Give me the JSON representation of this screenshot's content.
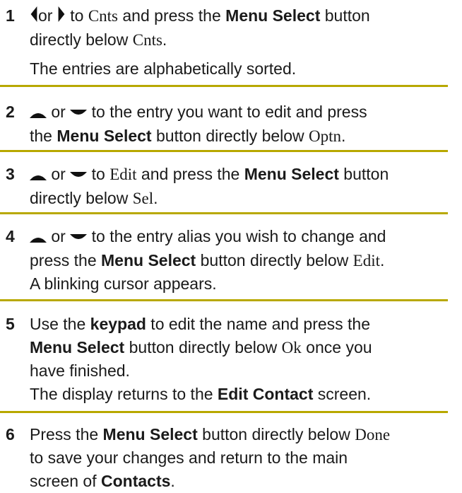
{
  "steps": [
    {
      "num": "1",
      "parts": [
        {
          "t": "icon",
          "name": "left-arrow-icon"
        },
        {
          "t": "text",
          "v": "or "
        },
        {
          "t": "icon",
          "name": "right-arrow-icon"
        },
        {
          "t": "text",
          "v": " to "
        },
        {
          "t": "serif",
          "v": "Cnts"
        },
        {
          "t": "text",
          "v": " and press the "
        },
        {
          "t": "bold",
          "v": "Menu Select"
        },
        {
          "t": "text",
          "v": " button"
        },
        {
          "t": "br"
        },
        {
          "t": "text",
          "v": "directly below "
        },
        {
          "t": "serif",
          "v": "Cnts"
        },
        {
          "t": "text",
          "v": "."
        }
      ],
      "note": "The entries are alphabetically sorted."
    },
    {
      "num": "2",
      "parts": [
        {
          "t": "icon",
          "name": "up-arrow-icon"
        },
        {
          "t": "text",
          "v": " or "
        },
        {
          "t": "icon",
          "name": "down-arrow-icon"
        },
        {
          "t": "text",
          "v": " to the entry you want to edit and press"
        },
        {
          "t": "br"
        },
        {
          "t": "text",
          "v": "the "
        },
        {
          "t": "bold",
          "v": "Menu Select"
        },
        {
          "t": "text",
          "v": " button directly below "
        },
        {
          "t": "serif",
          "v": "Optn"
        },
        {
          "t": "text",
          "v": "."
        }
      ]
    },
    {
      "num": "3",
      "parts": [
        {
          "t": "icon",
          "name": "up-arrow-icon"
        },
        {
          "t": "text",
          "v": " or "
        },
        {
          "t": "icon",
          "name": "down-arrow-icon"
        },
        {
          "t": "text",
          "v": " to "
        },
        {
          "t": "serif",
          "v": "Edit"
        },
        {
          "t": "text",
          "v": " and press the "
        },
        {
          "t": "bold",
          "v": "Menu Select"
        },
        {
          "t": "text",
          "v": " button"
        },
        {
          "t": "br"
        },
        {
          "t": "text",
          "v": "directly below "
        },
        {
          "t": "serif",
          "v": "Sel"
        },
        {
          "t": "text",
          "v": "."
        }
      ]
    },
    {
      "num": "4",
      "parts": [
        {
          "t": "icon",
          "name": "up-arrow-icon"
        },
        {
          "t": "text",
          "v": " or "
        },
        {
          "t": "icon",
          "name": "down-arrow-icon"
        },
        {
          "t": "text",
          "v": " to the entry alias you wish to change and"
        },
        {
          "t": "br"
        },
        {
          "t": "text",
          "v": "press the "
        },
        {
          "t": "bold",
          "v": "Menu Select"
        },
        {
          "t": "text",
          "v": " button directly below "
        },
        {
          "t": "serif",
          "v": "Edit"
        },
        {
          "t": "text",
          "v": "."
        },
        {
          "t": "br"
        },
        {
          "t": "text",
          "v": "A blinking cursor appears."
        }
      ]
    },
    {
      "num": "5",
      "parts": [
        {
          "t": "text",
          "v": "Use the "
        },
        {
          "t": "bold",
          "v": "keypad"
        },
        {
          "t": "text",
          "v": " to edit the name and press the"
        },
        {
          "t": "br"
        },
        {
          "t": "bold",
          "v": "Menu Select"
        },
        {
          "t": "text",
          "v": " button directly below "
        },
        {
          "t": "serif",
          "v": "Ok"
        },
        {
          "t": "text",
          "v": " once you"
        },
        {
          "t": "br"
        },
        {
          "t": "text",
          "v": "have finished."
        },
        {
          "t": "br"
        },
        {
          "t": "text",
          "v": "The display returns to the "
        },
        {
          "t": "bold",
          "v": "Edit Contact"
        },
        {
          "t": "text",
          "v": " screen."
        }
      ]
    },
    {
      "num": "6",
      "parts": [
        {
          "t": "text",
          "v": "Press the "
        },
        {
          "t": "bold",
          "v": "Menu Select"
        },
        {
          "t": "text",
          "v": " button directly below "
        },
        {
          "t": "serif",
          "v": "Done"
        },
        {
          "t": "br"
        },
        {
          "t": "text",
          "v": "to save your changes and return to the main"
        },
        {
          "t": "br"
        },
        {
          "t": "text",
          "v": "screen of "
        },
        {
          "t": "bold",
          "v": "Contacts"
        },
        {
          "t": "text",
          "v": "."
        }
      ]
    }
  ],
  "colors": {
    "rule": "#b8a800",
    "text": "#1a1a1a"
  }
}
